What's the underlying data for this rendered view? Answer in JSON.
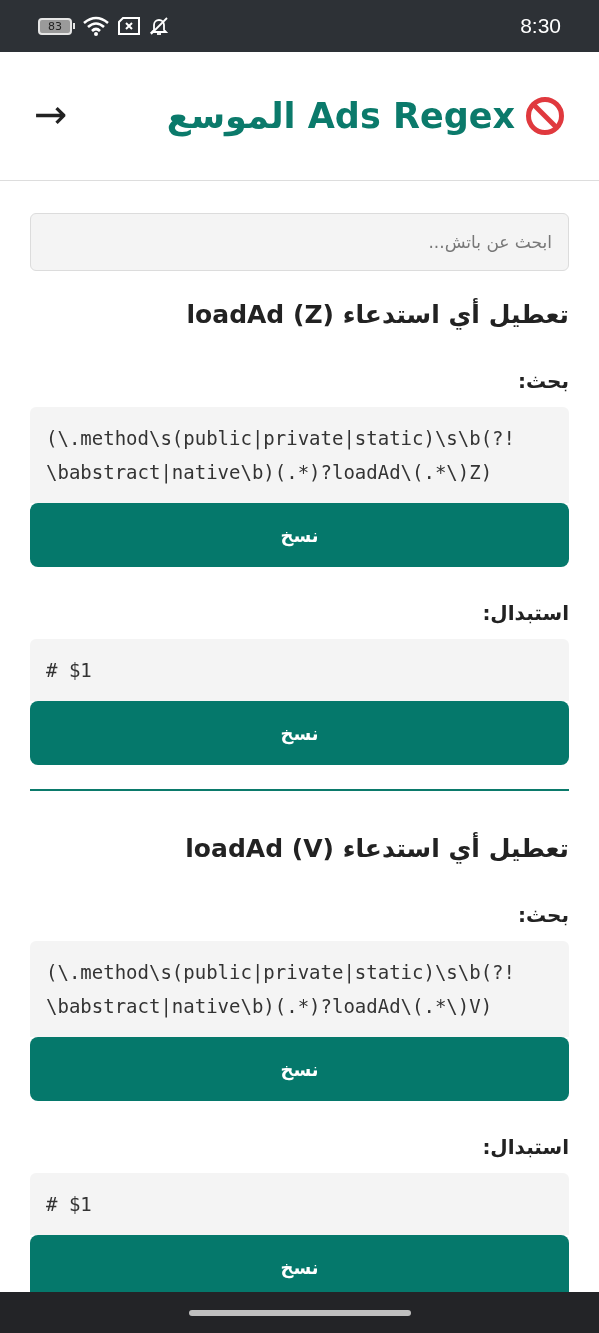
{
  "status_bar": {
    "battery": "83",
    "time": "8:30"
  },
  "header": {
    "back": "→",
    "title": "Ads Regex الموسع"
  },
  "search": {
    "placeholder": "ابحث عن باتش..."
  },
  "patches": [
    {
      "title": "تعطيل أي استدعاء (Z) loadAd",
      "blocks": [
        {
          "label": "بحث:",
          "code": "(\\.method\\s(public|private|static)\\s\\b(?!\\babstract|native\\b)(.*)?loadAd\\(.*\\)Z)",
          "button": "نسخ"
        },
        {
          "label": "استبدال:",
          "code": "# $1",
          "button": "نسخ"
        }
      ]
    },
    {
      "title": "تعطيل أي استدعاء (V) loadAd",
      "blocks": [
        {
          "label": "بحث:",
          "code": "(\\.method\\s(public|private|static)\\s\\b(?!\\babstract|native\\b)(.*)?loadAd\\(.*\\)V)",
          "button": "نسخ"
        },
        {
          "label": "استبدال:",
          "code": "# $1",
          "button": "نسخ"
        }
      ]
    }
  ]
}
